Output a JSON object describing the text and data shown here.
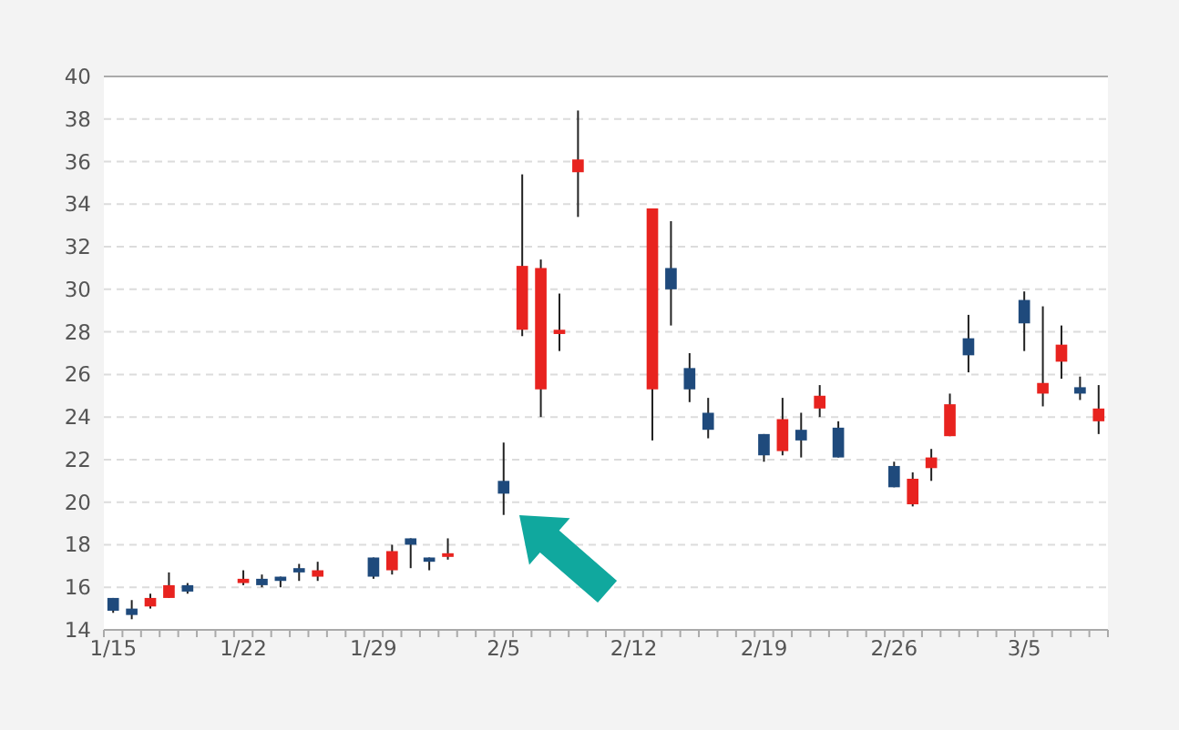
{
  "chart": {
    "chart_data": {
      "type": "candlestick",
      "categories": [
        "1/15",
        null,
        null,
        null,
        null,
        null,
        null,
        "1/22",
        null,
        null,
        null,
        null,
        null,
        null,
        "1/29",
        null,
        null,
        null,
        null,
        null,
        null,
        "2/5",
        null,
        null,
        null,
        null,
        null,
        null,
        "2/12",
        null,
        null,
        null,
        null,
        null,
        null,
        "2/19",
        null,
        null,
        null,
        null,
        null,
        null,
        "2/26",
        null,
        null,
        null,
        null,
        null,
        null,
        "3/5",
        null,
        null,
        null,
        null
      ],
      "ohlc": [
        [
          15.5,
          15.5,
          14.8,
          14.9
        ],
        [
          15.0,
          15.4,
          14.5,
          14.7
        ],
        [
          15.1,
          15.7,
          15.0,
          15.5
        ],
        [
          15.5,
          16.7,
          15.5,
          16.1
        ],
        [
          16.1,
          16.2,
          15.7,
          15.8
        ],
        null,
        null,
        [
          16.2,
          16.8,
          16.1,
          16.4
        ],
        [
          16.4,
          16.6,
          16.0,
          16.1
        ],
        [
          16.5,
          16.5,
          16.0,
          16.3
        ],
        [
          16.9,
          17.1,
          16.3,
          16.7
        ],
        [
          16.5,
          17.2,
          16.3,
          16.8
        ],
        null,
        null,
        [
          17.4,
          17.4,
          16.4,
          16.5
        ],
        [
          16.8,
          18.0,
          16.6,
          17.7
        ],
        [
          18.3,
          18.3,
          16.9,
          18.0
        ],
        [
          17.4,
          17.4,
          16.8,
          17.2
        ],
        [
          17.5,
          18.3,
          17.3,
          17.6
        ],
        null,
        null,
        [
          21.0,
          22.8,
          19.4,
          20.4
        ],
        [
          28.1,
          35.4,
          27.8,
          31.1
        ],
        [
          25.3,
          31.4,
          24.0,
          31.0
        ],
        [
          27.9,
          29.8,
          27.1,
          28.1
        ],
        [
          35.5,
          38.4,
          33.4,
          36.1
        ],
        null,
        null,
        null,
        [
          25.3,
          33.8,
          22.9,
          33.8
        ],
        [
          31.0,
          33.2,
          28.3,
          30.0
        ],
        [
          26.3,
          27.0,
          24.7,
          25.3
        ],
        [
          24.2,
          24.9,
          23.0,
          23.4
        ],
        null,
        null,
        [
          23.2,
          23.2,
          21.9,
          22.2
        ],
        [
          22.4,
          24.9,
          22.2,
          23.9
        ],
        [
          23.4,
          24.2,
          22.1,
          22.9
        ],
        [
          24.4,
          25.5,
          24.0,
          25.0
        ],
        [
          23.5,
          23.8,
          22.1,
          22.1
        ],
        null,
        null,
        [
          21.7,
          21.9,
          20.7,
          20.7
        ],
        [
          19.9,
          21.4,
          19.8,
          21.1
        ],
        [
          21.6,
          22.5,
          21.0,
          22.1
        ],
        [
          23.1,
          25.1,
          23.1,
          24.6
        ],
        [
          27.7,
          28.8,
          26.1,
          26.9
        ],
        null,
        null,
        [
          29.5,
          29.9,
          27.1,
          28.4
        ],
        [
          25.1,
          29.2,
          24.5,
          25.6
        ],
        [
          26.6,
          28.3,
          25.8,
          27.4
        ],
        [
          25.4,
          25.9,
          24.8,
          25.1
        ],
        [
          23.8,
          25.5,
          23.2,
          24.4
        ]
      ],
      "ylim": [
        14,
        40
      ],
      "yticks": [
        14,
        16,
        18,
        20,
        22,
        24,
        26,
        28,
        30,
        32,
        34,
        36,
        38,
        40
      ],
      "grid": true
    }
  }
}
